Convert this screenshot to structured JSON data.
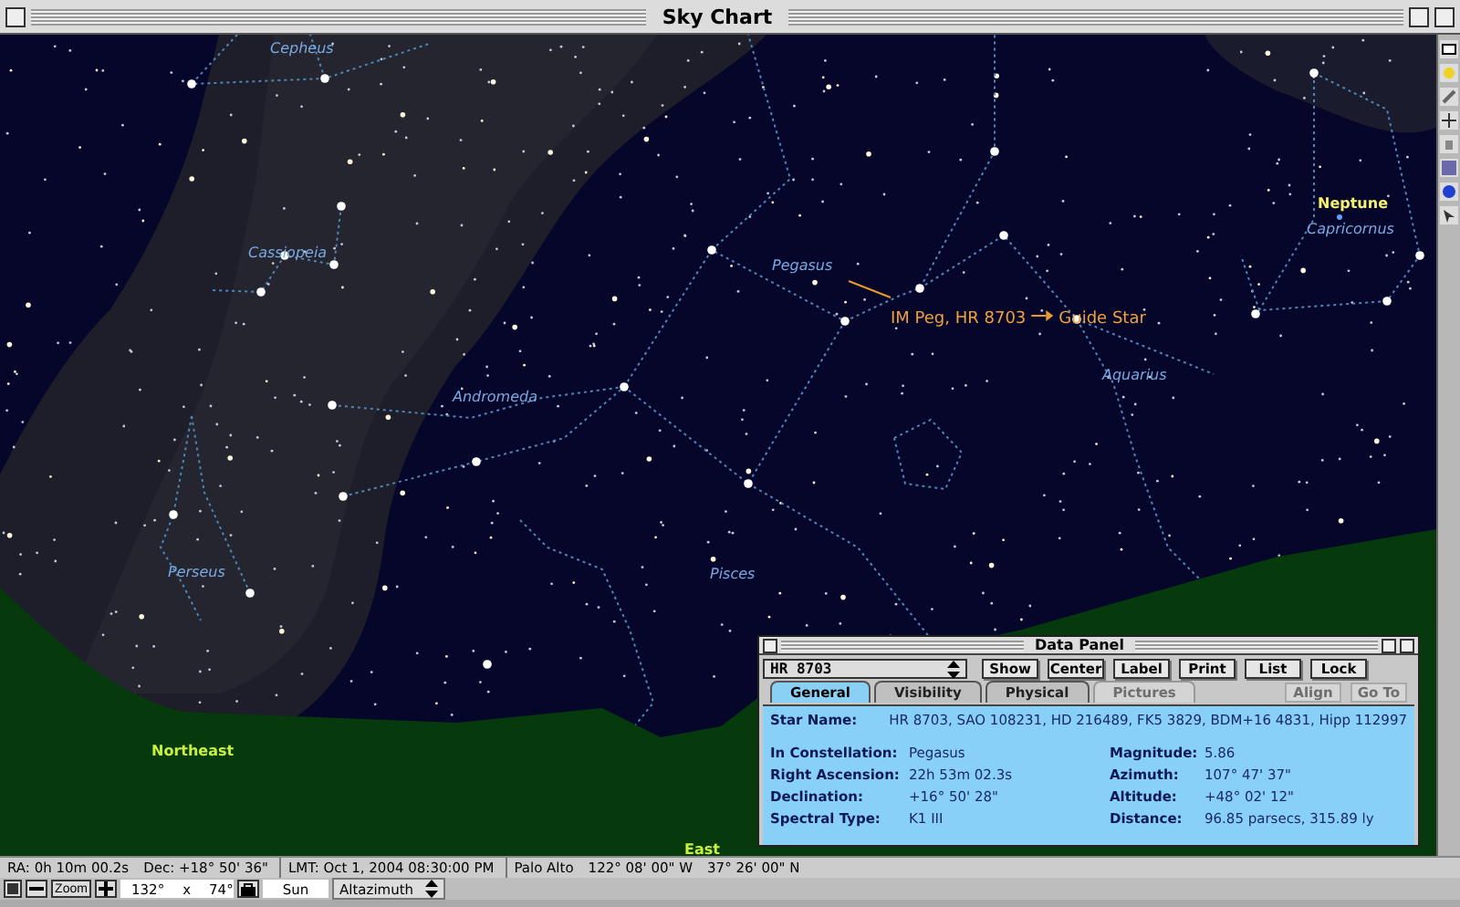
{
  "window": {
    "title": "Sky Chart"
  },
  "chart": {
    "constellations": [
      "Cepheus",
      "Cassiopeia",
      "Andromeda",
      "Perseus",
      "Pisces",
      "Pegasus",
      "Aquarius",
      "Capricornus"
    ],
    "planets": [
      {
        "name": "Neptune"
      }
    ],
    "horizon_labels": [
      "Northeast",
      "East"
    ],
    "annotation": {
      "object": "IM Peg, HR  8703",
      "target": "Guide Star"
    }
  },
  "data_panel": {
    "title": "Data Panel",
    "object": "HR 8703",
    "buttons": [
      {
        "label": "Show",
        "disabled": false
      },
      {
        "label": "Center",
        "disabled": false
      },
      {
        "label": "Label",
        "disabled": false
      },
      {
        "label": "Print",
        "disabled": false
      },
      {
        "label": "List",
        "disabled": false
      },
      {
        "label": "Lock",
        "disabled": false
      }
    ],
    "tabs": [
      {
        "label": "General",
        "selected": true,
        "disabled": false
      },
      {
        "label": "Visibility",
        "selected": false,
        "disabled": false
      },
      {
        "label": "Physical",
        "selected": false,
        "disabled": false
      },
      {
        "label": "Pictures",
        "selected": false,
        "disabled": true
      }
    ],
    "buttons_lower": [
      {
        "label": "Align",
        "disabled": true
      },
      {
        "label": "Go To",
        "disabled": true
      }
    ],
    "star_name": {
      "label": "Star Name:",
      "value": "HR 8703, SAO 108231, HD 216489, FK5 3829, BDM+16 4831, Hipp 112997"
    },
    "fields_left": [
      {
        "label": "In Constellation:",
        "value": "Pegasus"
      },
      {
        "label": "Right Ascension:",
        "value": "22h 53m 02.3s"
      },
      {
        "label": "Declination:",
        "value": "+16° 50' 28\""
      },
      {
        "label": "Spectral Type:",
        "value": "K1 III"
      }
    ],
    "fields_right": [
      {
        "label": "Magnitude:",
        "value": "5.86"
      },
      {
        "label": "Azimuth:",
        "value": "107° 47' 37\""
      },
      {
        "label": "Altitude:",
        "value": "+48° 02' 12\""
      },
      {
        "label": "Distance:",
        "value": "96.85 parsecs, 315.89 ly"
      }
    ]
  },
  "status_bar": {
    "ra": "RA:  0h 10m 00.2s",
    "dec": "Dec:  +18° 50' 36\"",
    "lmt": "LMT:   Oct  1, 2004     08:30:00 PM",
    "location": "Palo Alto",
    "longitude": "122° 08' 00\" W",
    "latitude": "37° 26' 00\" N"
  },
  "toolbar": {
    "zoom": "Zoom",
    "fov_width": "132°",
    "fov_x": "x",
    "fov_height": "74°",
    "center_object": "Sun",
    "mode": "Altazimuth"
  }
}
